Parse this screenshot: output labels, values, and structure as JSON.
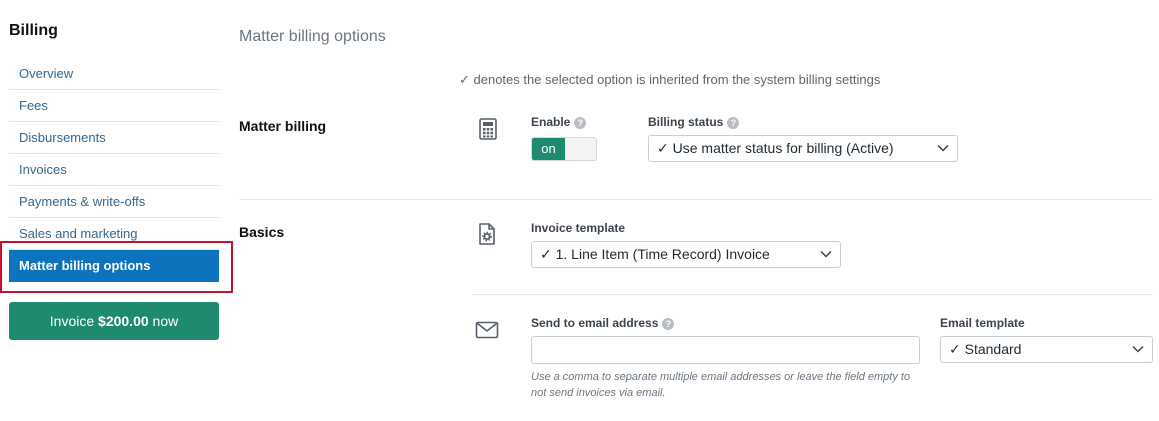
{
  "sidebar": {
    "title": "Billing",
    "items": [
      {
        "label": "Overview"
      },
      {
        "label": "Fees"
      },
      {
        "label": "Disbursements"
      },
      {
        "label": "Invoices"
      },
      {
        "label": "Payments & write-offs"
      },
      {
        "label": "Sales and marketing"
      },
      {
        "label": "Matter billing options",
        "active": true
      }
    ],
    "invoice_button": {
      "prefix": "Invoice ",
      "amount": "$200.00",
      "suffix": " now"
    }
  },
  "main": {
    "title": "Matter billing options",
    "inherit_note": "✓ denotes the selected option is inherited from the system billing settings",
    "matter_billing": {
      "label": "Matter billing",
      "icon": "calculator-icon",
      "enable_label": "Enable",
      "toggle_value": "on",
      "billing_status_label": "Billing status",
      "billing_status_value": "✓ Use matter status for billing (Active)"
    },
    "basics": {
      "label": "Basics",
      "icon": "document-gear-icon",
      "invoice_template_label": "Invoice template",
      "invoice_template_value": "✓ 1. Line Item (Time Record) Invoice",
      "email_icon": "envelope-icon",
      "send_to_email_label": "Send to email address",
      "send_to_email_value": "",
      "email_hint": "Use a comma to separate multiple email addresses or leave the field empty to not send invoices via email.",
      "email_template_label": "Email template",
      "email_template_value": "✓ Standard"
    }
  },
  "colors": {
    "accent_blue": "#0e73bd",
    "accent_green": "#1e8a6f",
    "highlight_red": "#c8102e",
    "link": "#33688f"
  }
}
